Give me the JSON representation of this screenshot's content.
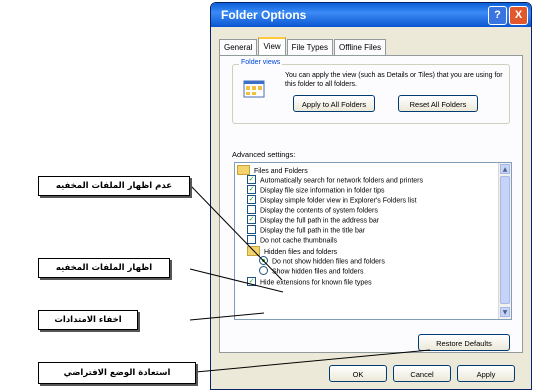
{
  "dialog": {
    "title": "Folder Options",
    "help_glyph": "?",
    "close_glyph": "X",
    "tabs": [
      {
        "label": "General"
      },
      {
        "label": "View"
      },
      {
        "label": "File Types"
      },
      {
        "label": "Offline Files"
      }
    ],
    "active_tab": "View",
    "folder_views": {
      "title": "Folder views",
      "description": "You can apply the view (such as Details or Tiles) that you are using for this folder to all folders.",
      "apply_button": "Apply to All Folders",
      "reset_button": "Reset All Folders"
    },
    "advanced": {
      "label": "Advanced settings:",
      "items": [
        {
          "type": "folder",
          "label": "Files and Folders"
        },
        {
          "type": "checkbox",
          "checked": true,
          "label": "Automatically search for network folders and printers"
        },
        {
          "type": "checkbox",
          "checked": true,
          "label": "Display file size information in folder tips"
        },
        {
          "type": "checkbox",
          "checked": true,
          "label": "Display simple folder view in Explorer's Folders list"
        },
        {
          "type": "checkbox",
          "checked": false,
          "label": "Display the contents of system folders"
        },
        {
          "type": "checkbox",
          "checked": true,
          "label": "Display the full path in the address bar"
        },
        {
          "type": "checkbox",
          "checked": false,
          "label": "Display the full path in the title bar"
        },
        {
          "type": "checkbox",
          "checked": false,
          "label": "Do not cache thumbnails"
        },
        {
          "type": "folder",
          "label": "Hidden files and folders"
        },
        {
          "type": "radio",
          "checked": true,
          "label": "Do not show hidden files and folders"
        },
        {
          "type": "radio",
          "checked": false,
          "label": "Show hidden files and folders"
        },
        {
          "type": "checkbox",
          "checked": true,
          "label": "Hide extensions for known file types"
        }
      ]
    },
    "restore_button": "Restore Defaults",
    "ok_button": "OK",
    "cancel_button": "Cancel",
    "apply_button": "Apply"
  },
  "callouts": {
    "dont_show_hidden": "عدم اظهار الملفات المخفيه",
    "show_hidden": "اظهار الملفات المخفيه",
    "hide_extensions": "اخفاء الامتدادات",
    "restore_defaults": "استعادة الوضع الافتراضي"
  },
  "colors": {
    "titlebar": "#0a5fd8",
    "dialog_bg": "#ece9d8",
    "check_mark": "#21a121"
  }
}
